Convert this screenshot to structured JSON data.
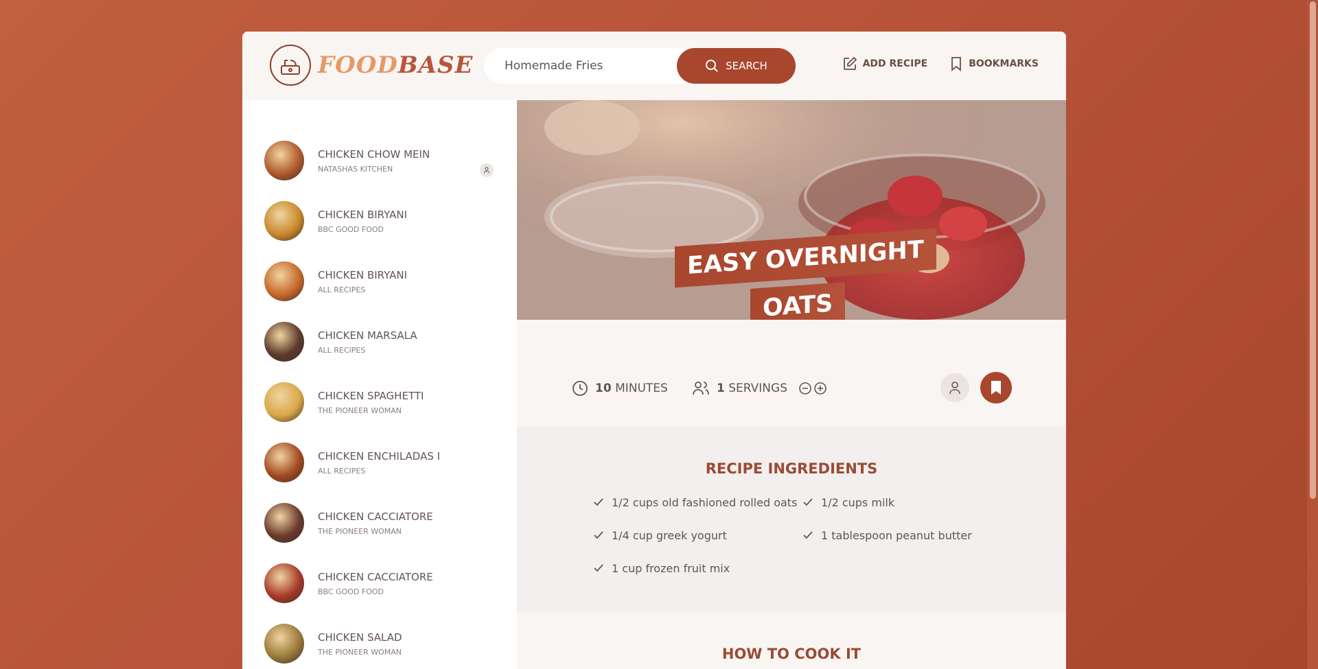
{
  "header": {
    "logo_part1": "FOOD",
    "logo_part2": "BASE",
    "search_value": "Homemade Fries",
    "search_button": "SEARCH",
    "nav": {
      "add_recipe": "ADD RECIPE",
      "bookmarks": "BOOKMARKS"
    }
  },
  "sidebar": {
    "items": [
      {
        "title": "CHICKEN CHOW MEIN",
        "publisher": "NATASHAS KITCHEN",
        "thumb_color": "#b05a2c",
        "user": true
      },
      {
        "title": "CHICKEN BIRYANI",
        "publisher": "BBC GOOD FOOD",
        "thumb_color": "#c98a2d"
      },
      {
        "title": "CHICKEN BIRYANI",
        "publisher": "ALL RECIPES",
        "thumb_color": "#c6692a"
      },
      {
        "title": "CHICKEN MARSALA",
        "publisher": "ALL RECIPES",
        "thumb_color": "#5d3a2c"
      },
      {
        "title": "CHICKEN SPAGHETTI",
        "publisher": "THE PIONEER WOMAN",
        "thumb_color": "#d9a84a"
      },
      {
        "title": "CHICKEN ENCHILADAS I",
        "publisher": "ALL RECIPES",
        "thumb_color": "#a34a22"
      },
      {
        "title": "CHICKEN CACCIATORE",
        "publisher": "THE PIONEER WOMAN",
        "thumb_color": "#6b3a2e"
      },
      {
        "title": "CHICKEN CACCIATORE",
        "publisher": "BBC GOOD FOOD",
        "thumb_color": "#a63a2a"
      },
      {
        "title": "CHICKEN SALAD",
        "publisher": "THE PIONEER WOMAN",
        "thumb_color": "#9a7a3a"
      }
    ]
  },
  "recipe": {
    "title_line1": "EASY OVERNIGHT",
    "title_line2": "OATS",
    "cook_time": "10",
    "cook_time_unit": "MINUTES",
    "servings": "1",
    "servings_unit": "SERVINGS",
    "ingredients_heading": "RECIPE INGREDIENTS",
    "ingredients": [
      "1/2 cups old fashioned rolled oats",
      "1/2 cups milk",
      "1/4 cup greek yogurt",
      "1 tablespoon peanut butter",
      "1 cup frozen fruit mix"
    ],
    "how_to_heading": "HOW TO COOK IT"
  },
  "colors": {
    "accent": "#a8462e",
    "brand_light": "#e59a66",
    "text": "#615551"
  }
}
